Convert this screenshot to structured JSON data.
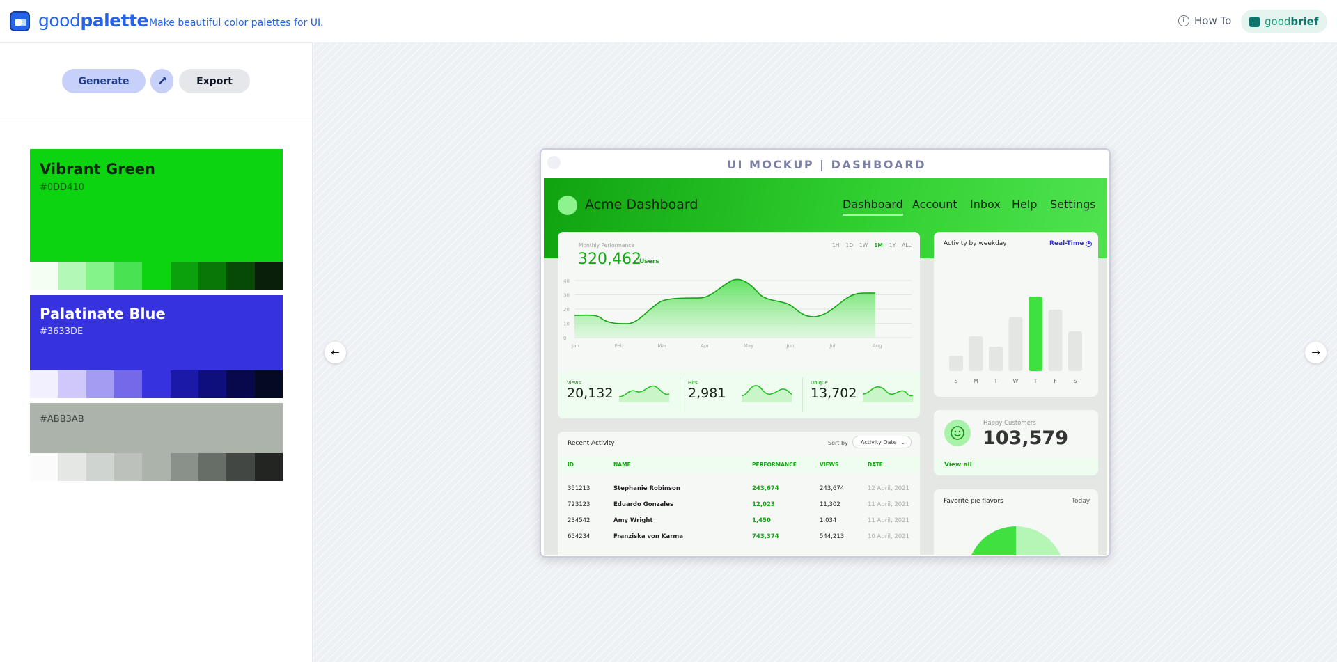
{
  "header": {
    "brand_light": "good",
    "brand_bold": "palette",
    "tagline": "Make beautiful color palettes for UI.",
    "howto_icon": "i",
    "howto_label": "How To",
    "goodbrief_light": "good",
    "goodbrief_bold": "brief"
  },
  "toolbar": {
    "generate_label": "Generate",
    "export_label": "Export"
  },
  "palettes": [
    {
      "name": "Vibrant Green",
      "hex": "#0DD410",
      "shades": [
        "#f4fff3",
        "#b3f8b6",
        "#84f48a",
        "#48e252",
        "#0dd410",
        "#0ba10d",
        "#087708",
        "#064a06",
        "#0a1f0a"
      ]
    },
    {
      "name": "Palatinate Blue",
      "hex": "#3633DE",
      "shades": [
        "#f2f0ff",
        "#d0c8fa",
        "#a39cf2",
        "#7469e8",
        "#3633de",
        "#1b1aa8",
        "#0e0e7c",
        "#08094c",
        "#050a24"
      ]
    },
    {
      "name": "",
      "hex": "#ABB3AB",
      "shades": [
        "#fafbfa",
        "#e4e7e4",
        "#d0d4d0",
        "#bcc1bc",
        "#abb3ab",
        "#8a908a",
        "#676d67",
        "#434743",
        "#232523"
      ]
    }
  ],
  "nav": {
    "prev_icon": "←",
    "next_icon": "→"
  },
  "mockup": {
    "title": "UI MOCKUP | DASHBOARD",
    "dashboard_title": "Acme Dashboard",
    "nav": [
      "Dashboard",
      "Account",
      "Inbox",
      "Help",
      "Settings"
    ],
    "perf": {
      "label": "Monthly Performance",
      "value": "320,462",
      "unit": "Users",
      "ranges": [
        "1H",
        "1D",
        "1W",
        "1M",
        "1Y",
        "ALL"
      ],
      "yticks": [
        "40",
        "30",
        "20",
        "10",
        "0"
      ],
      "months": [
        "Jan",
        "Feb",
        "Mar",
        "Apr",
        "May",
        "Jun",
        "Jul",
        "Aug"
      ],
      "stats": [
        {
          "label": "Views",
          "value": "20,132"
        },
        {
          "label": "Hits",
          "value": "2,981"
        },
        {
          "label": "Unique",
          "value": "13,702"
        }
      ]
    },
    "weekday": {
      "title": "Activity by weekday",
      "toggle": "Real-Time",
      "days": [
        "S",
        "M",
        "T",
        "W",
        "T",
        "F",
        "S"
      ],
      "values": [
        22,
        50,
        35,
        77,
        107,
        88,
        57
      ]
    },
    "customers": {
      "label": "Happy Customers",
      "value": "103,579",
      "link": "View all"
    },
    "pie": {
      "title": "Favorite pie flavors",
      "period": "Today"
    },
    "activity": {
      "title": "Recent Activity",
      "sort_label": "Sort by",
      "sort_value": "Activity Date",
      "columns": [
        "ID",
        "NAME",
        "PERFORMANCE",
        "VIEWS",
        "DATE"
      ],
      "rows": [
        [
          "351213",
          "Stephanie Robinson",
          "243,674",
          "243,674",
          "12 April, 2021"
        ],
        [
          "723123",
          "Eduardo Gonzales",
          "12,023",
          "11,302",
          "11 April, 2021"
        ],
        [
          "234542",
          "Amy Wright",
          "1,450",
          "1,034",
          "11 April, 2021"
        ],
        [
          "654234",
          "Franziska von Karma",
          "743,374",
          "544,213",
          "10 April, 2021"
        ]
      ]
    }
  }
}
